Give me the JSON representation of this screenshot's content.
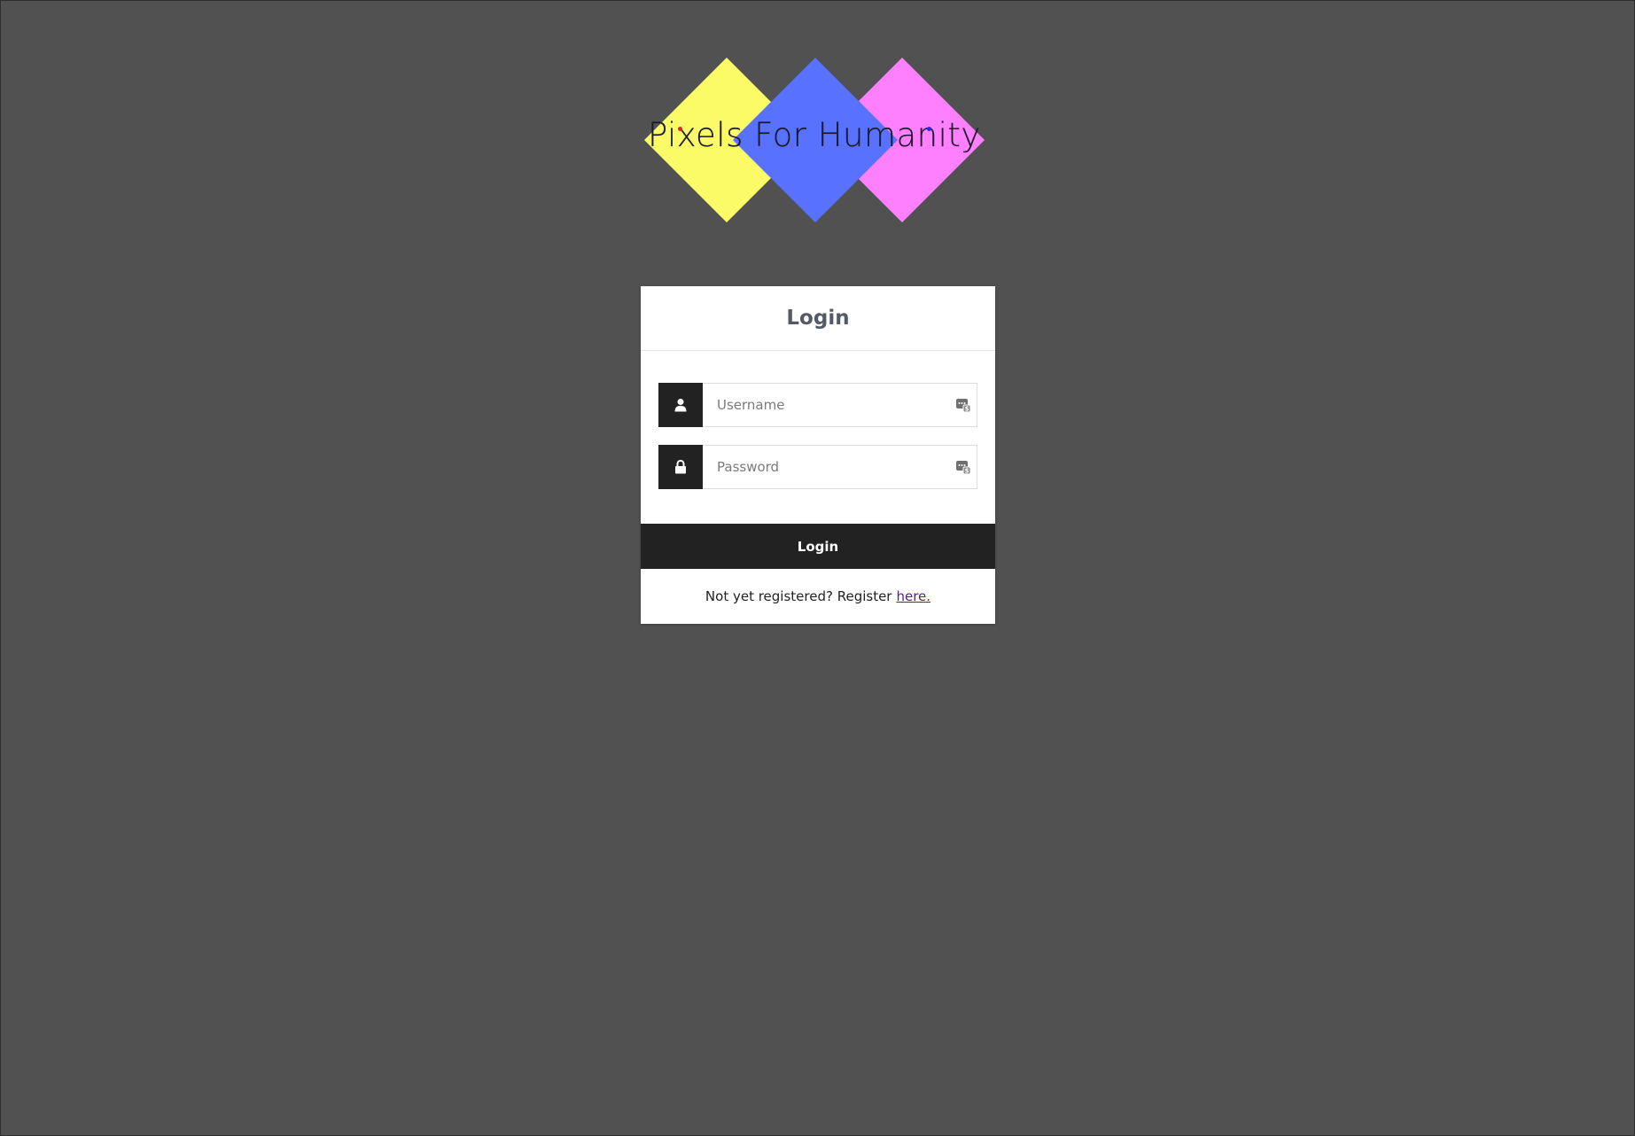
{
  "branding": {
    "logo_text": "Pixels For Humanity",
    "colors": {
      "yellow": "#fbfb68",
      "blue": "#5872ff",
      "pink": "#ff80ff",
      "page_background": "#515151",
      "dark": "#222222"
    }
  },
  "login_card": {
    "title": "Login",
    "username": {
      "placeholder": "Username",
      "value": "",
      "icon": "user-icon"
    },
    "password": {
      "placeholder": "Password",
      "value": "",
      "icon": "lock-icon"
    },
    "submit_label": "Login",
    "footer": {
      "text": "Not yet registered? Register",
      "link_label": "here."
    }
  }
}
